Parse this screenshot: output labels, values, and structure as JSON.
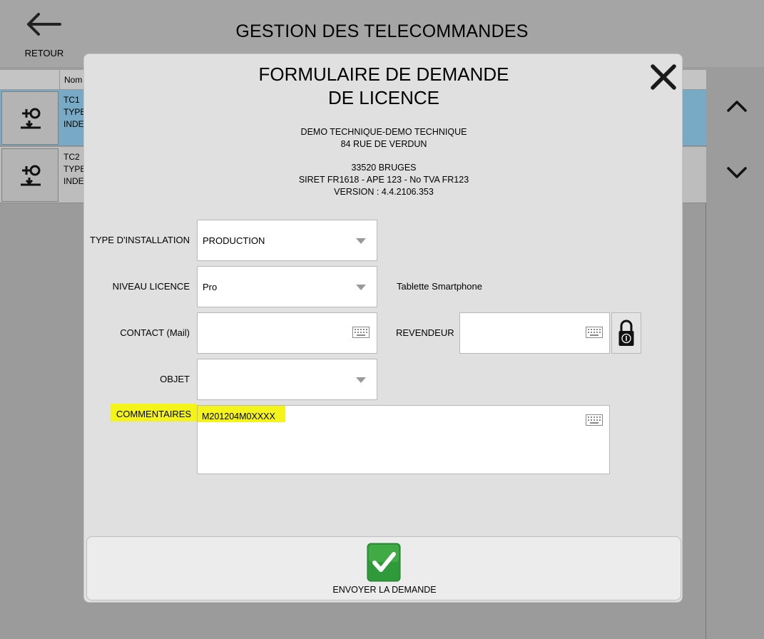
{
  "header": {
    "back_label": "RETOUR",
    "title": "GESTION DES TELECOMMANDES"
  },
  "grid": {
    "column_nom": "Nom",
    "rows": [
      {
        "lines": [
          "TC1",
          "TYPE",
          "INDE"
        ],
        "selected": true
      },
      {
        "lines": [
          "TC2",
          "TYPE",
          "INDE"
        ],
        "selected": false
      }
    ]
  },
  "modal": {
    "title_line1": "FORMULAIRE DE DEMANDE",
    "title_line2": "DE LICENCE",
    "company": {
      "line1": "DEMO TECHNIQUE-DEMO TECHNIQUE",
      "line2": "84 RUE DE VERDUN",
      "line3": "33520 BRUGES",
      "line4": "SIRET FR1618 - APE 123 - No TVA FR123",
      "line5": "VERSION : 4.4.2106.353"
    },
    "form": {
      "type_label": "TYPE D'INSTALLATION",
      "type_value": "PRODUCTION",
      "niveau_label": "NIVEAU LICENCE",
      "niveau_value": "Pro",
      "niveau_note": "Tablette Smartphone",
      "contact_label": "CONTACT (Mail)",
      "contact_value": "",
      "revendeur_label": "REVENDEUR",
      "revendeur_value": "",
      "objet_label": "OBJET",
      "objet_value": "",
      "commentaires_label": "COMMENTAIRES",
      "commentaires_value": "M201204M0XXXX"
    },
    "send_label": "ENVOYER LA DEMANDE"
  },
  "colors": {
    "selected_row": "#78aac5",
    "highlight": "#f4f41b",
    "send_green": "#2f9a3a"
  },
  "icons": [
    "back-arrow-icon",
    "remote-key-icon",
    "chevron-up-icon",
    "chevron-down-icon",
    "close-icon",
    "keyboard-icon",
    "lock-icon",
    "checkmark-icon",
    "dropdown-arrow-icon"
  ]
}
